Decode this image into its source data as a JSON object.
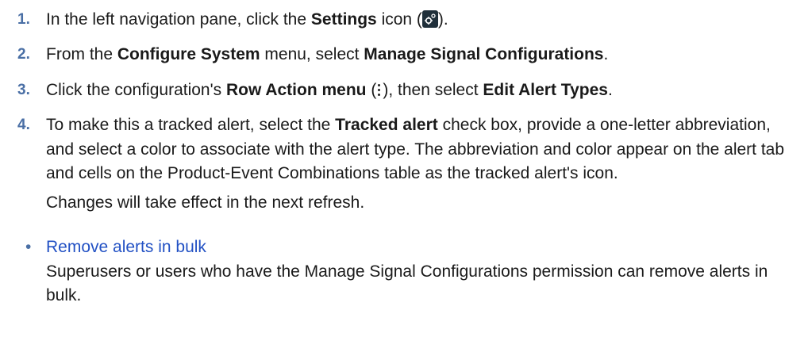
{
  "steps": [
    {
      "number": "1.",
      "pre": "In the left navigation pane, click the ",
      "bold1": "Settings",
      "mid": " icon (",
      "post": ")."
    },
    {
      "number": "2.",
      "pre": "From the ",
      "bold1": "Configure System",
      "mid": " menu, select ",
      "bold2": "Manage Signal Configurations",
      "post": "."
    },
    {
      "number": "3.",
      "pre": "Click the configuration's ",
      "bold1": "Row Action menu",
      "mid": " (",
      "mid2": "), then select ",
      "bold2": "Edit Alert Types",
      "post": "."
    },
    {
      "number": "4.",
      "pre": "To make this a tracked alert, select the ",
      "bold1": "Tracked alert",
      "post": " check box, provide a one-letter abbreviation, and select a color to associate with the alert type. The abbreviation and color appear on the alert tab and cells on the Product-Event Combinations table as the tracked alert's icon.",
      "note": "Changes will take effect in the next refresh."
    }
  ],
  "related": {
    "bullet": "•",
    "link": "Remove alerts in bulk",
    "description": "Superusers or users who have the Manage Signal Configurations permission can remove alerts in bulk."
  },
  "icons": {
    "settings": "settings-gear-icon",
    "row_action": "kebab-menu-icon"
  },
  "colors": {
    "step_number": "#4a6fa5",
    "link": "#2251c4",
    "text": "#1a1a1a"
  }
}
